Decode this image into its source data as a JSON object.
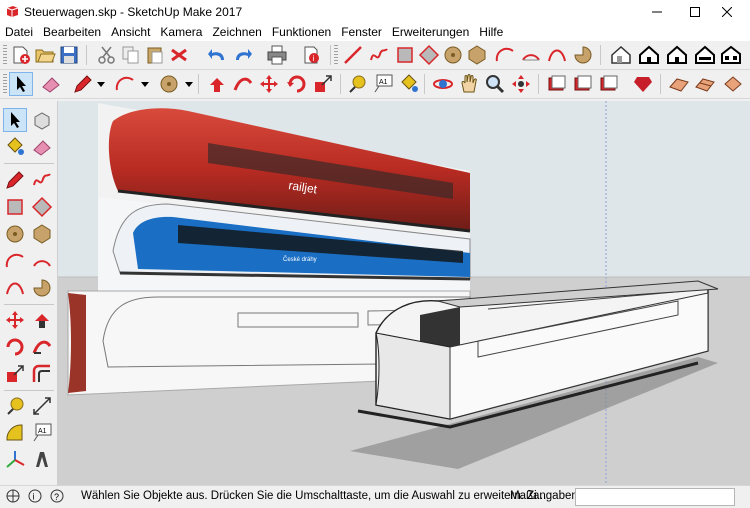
{
  "window": {
    "title": "Steuerwagen.skp - SketchUp Make 2017"
  },
  "menu": [
    "Datei",
    "Bearbeiten",
    "Ansicht",
    "Kamera",
    "Zeichnen",
    "Funktionen",
    "Fenster",
    "Erweiterungen",
    "Hilfe"
  ],
  "toolbar1": [
    "new",
    "open",
    "save",
    "cut",
    "copy",
    "paste",
    "erase",
    "undo",
    "redo",
    "print",
    "model-info",
    "line",
    "freehand",
    "arc",
    "2-point-arc",
    "pie",
    "circle",
    "polygon",
    "rectangle",
    "rotated-rectangle",
    "3d-warehouse",
    "send-to-layout",
    "extension-warehouse",
    "house",
    "house-front",
    "house-back",
    "house-side"
  ],
  "toolbar2": [
    "select",
    "eraser",
    "line",
    "arc",
    "shapes",
    "push-pull",
    "follow-me",
    "move",
    "rotate",
    "scale",
    "offset",
    "tape-measure",
    "text",
    "paint-bucket",
    "orbit",
    "pan",
    "zoom",
    "zoom-extents",
    "components-1",
    "components-2",
    "components-3",
    "sandbox",
    "section-plane",
    "walk"
  ],
  "left_tools": [
    "select",
    "make-component",
    "paint-bucket",
    "eraser",
    "line",
    "freehand",
    "rectangle",
    "rotated-rectangle",
    "circle",
    "polygon",
    "arc",
    "2-point-arc",
    "3-point-arc",
    "pie",
    "move",
    "push-pull",
    "rotate",
    "follow-me",
    "scale",
    "offset",
    "tape-measure",
    "dimension",
    "protractor",
    "text",
    "axes",
    "3d-text"
  ],
  "viewport": {
    "label_railjet": "railjet",
    "label_cd": "České dráhy"
  },
  "status": {
    "message": "Wählen Sie Objekte aus. Drücken Sie die Umschalttaste, um die Auswahl zu erweitern. Zi...",
    "measure_label": "Maßangaben",
    "measure_value": ""
  },
  "colors": {
    "sky": "#dfe6ea",
    "ground": "#cfcfcf",
    "accent": "#1f6fd0",
    "railjet_red": "#c8322a",
    "cd_blue": "#1a6fc4"
  }
}
